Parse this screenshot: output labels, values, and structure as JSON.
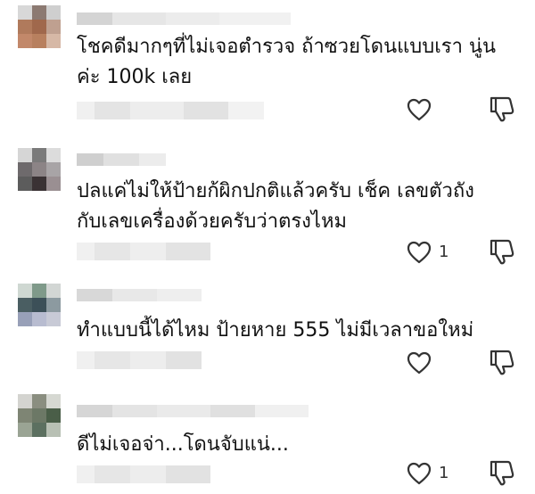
{
  "comments": [
    {
      "lines": [
        "โชคดีมากๆที่ไม่เจอตำรวจ ถ้าซวยโดนแบบเรา นู่น",
        "ค่ะ 100k เลย"
      ],
      "like_count": "",
      "avatar_icon": "avatar-icon",
      "like_icon": "heart-outline-icon",
      "dislike_icon": "thumbs-down-icon"
    },
    {
      "lines": [
        "ปลแค่ไม่ให้ป้ายก้ผิกปกติแล้วครับ เช็ค เลขตัวถัง",
        "กับเลขเครื่องด้วยครับว่าตรงไหม"
      ],
      "like_count": "1",
      "avatar_icon": "avatar-icon",
      "like_icon": "heart-outline-icon",
      "dislike_icon": "thumbs-down-icon"
    },
    {
      "lines": [
        "ทำแบบนี้ได้ไหม ป้ายหาย 555 ไม่มีเวลาขอใหม่"
      ],
      "like_count": "",
      "avatar_icon": "avatar-icon",
      "like_icon": "heart-outline-icon",
      "dislike_icon": "thumbs-down-icon"
    },
    {
      "lines": [
        "ดีไม่เจอจ่า...โดนจับแน่..."
      ],
      "like_count": "1",
      "avatar_icon": "avatar-icon",
      "like_icon": "heart-outline-icon",
      "dislike_icon": "thumbs-down-icon"
    }
  ],
  "colors": {
    "text": "#111111",
    "icon": "#333333",
    "blur_light": "#ececec",
    "blur_mid": "#dcdcdc"
  }
}
